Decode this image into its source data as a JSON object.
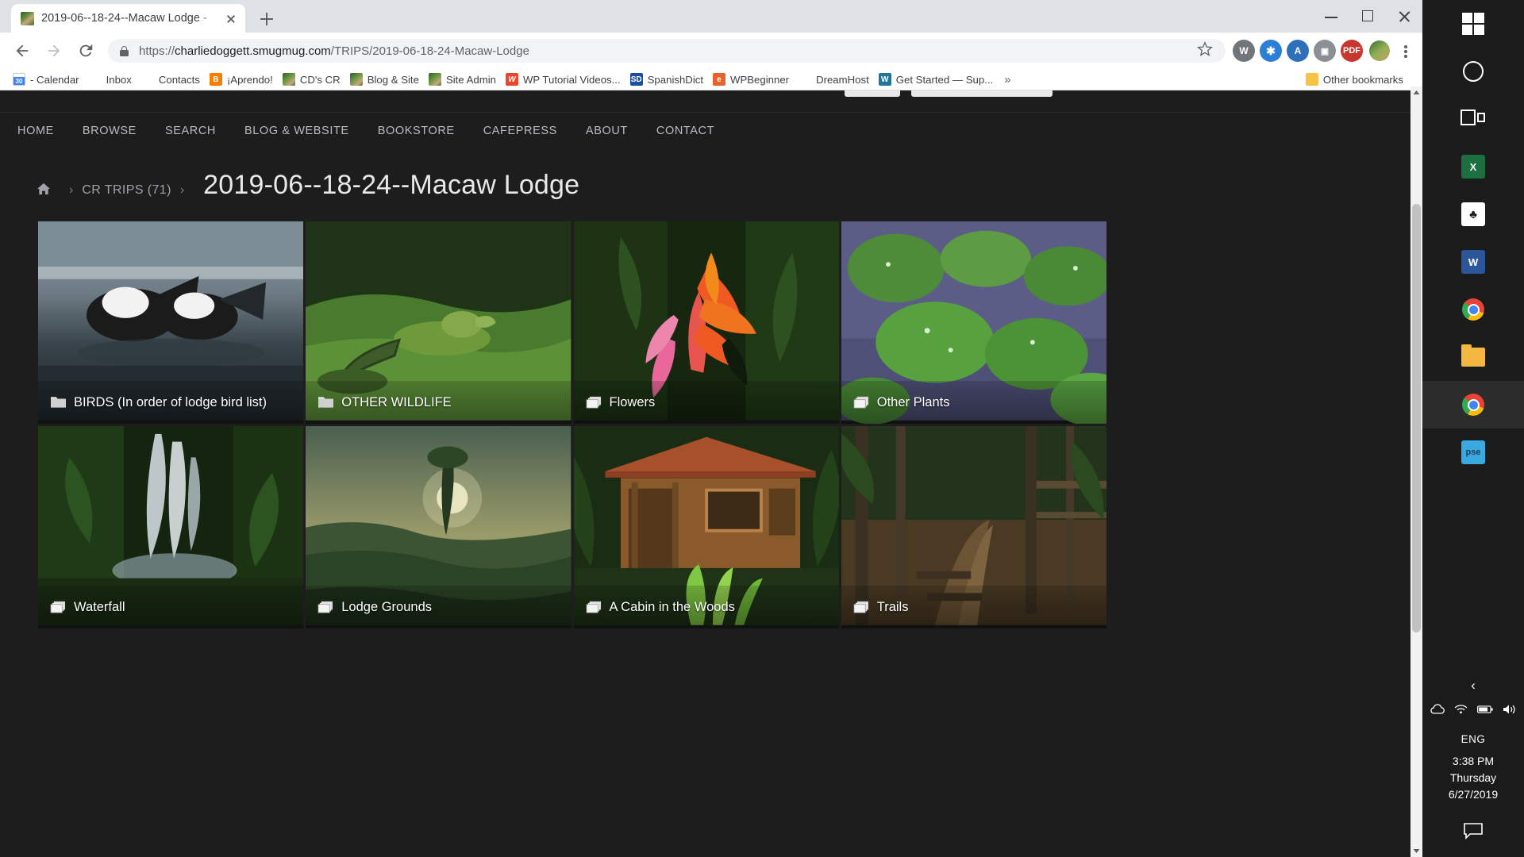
{
  "browser": {
    "tab": {
      "title": "2019-06--18-24--Macaw Lodge -",
      "favicon": "photo-favicon"
    },
    "newtab_label": "+",
    "window_controls": {
      "minimize": "minimize",
      "maximize": "maximize",
      "close": "close"
    },
    "nav": {
      "back": "back-arrow",
      "forward": "forward-arrow",
      "reload": "reload-icon"
    },
    "omnibox": {
      "lock": "secure-lock-icon",
      "url_scheme": "https://",
      "url_main": "charliedoggett.smugmug.com",
      "url_path": "/TRIPS/2019-06-18-24-Macaw-Lodge",
      "url_full": "https://charliedoggett.smugmug.com/TRIPS/2019-06-18-24-Macaw-Lodge",
      "bookmark_star": "star-icon"
    },
    "extensions": [
      {
        "name": "wordpress-extension",
        "label": "W",
        "color": "#5a5a5a"
      },
      {
        "name": "grammar-extension",
        "label": "✻",
        "color": "#2b7fd4"
      },
      {
        "name": "acrobat-extension-a",
        "label": "A",
        "color": "#2d6fb8"
      },
      {
        "name": "screen-extension",
        "label": "▣",
        "color": "#7a7a7a"
      },
      {
        "name": "pdf-extension",
        "label": "⌂",
        "color": "#c8372d"
      }
    ],
    "profile_avatar": "user-avatar",
    "menu": "chrome-menu-icon",
    "bookmarks": [
      {
        "label": "- Calendar",
        "icon": "calendar-icon"
      },
      {
        "label": "Inbox",
        "icon": "gmail-icon"
      },
      {
        "label": "Contacts",
        "icon": "gmail-icon"
      },
      {
        "label": "¡Aprendo!",
        "icon": "blogger-icon"
      },
      {
        "label": "CD's CR",
        "icon": "photo-icon"
      },
      {
        "label": "Blog & Site",
        "icon": "photo-icon"
      },
      {
        "label": "Site Admin",
        "icon": "photo-icon"
      },
      {
        "label": "WP Tutorial Videos...",
        "icon": "wordpress-icon"
      },
      {
        "label": "SpanishDict",
        "icon": "spanishdict-icon"
      },
      {
        "label": "WPBeginner",
        "icon": "wpbeginner-icon"
      },
      {
        "label": "DreamHost",
        "icon": "dreamhost-icon"
      },
      {
        "label": "Get Started — Sup...",
        "icon": "wordpress-circle-icon"
      }
    ],
    "bookmarks_overflow": "»",
    "other_bookmarks": {
      "label": "Other bookmarks",
      "icon": "folder-icon"
    }
  },
  "site": {
    "nav_items": [
      {
        "label": "HOME"
      },
      {
        "label": "BROWSE"
      },
      {
        "label": "SEARCH"
      },
      {
        "label": "BLOG & WEBSITE"
      },
      {
        "label": "BOOKSTORE"
      },
      {
        "label": "CAFEPRESS"
      },
      {
        "label": "ABOUT"
      },
      {
        "label": "CONTACT"
      }
    ],
    "breadcrumb": {
      "home_icon": "home-icon",
      "separator": "›",
      "parent": "CR TRIPS (71)",
      "title": "2019-06--18-24--Macaw Lodge"
    },
    "gallery": [
      {
        "caption": "BIRDS (In order of lodge bird list)",
        "icon": "folder-icon",
        "alt": "two black-and-white ducks splashing in water"
      },
      {
        "caption": "OTHER WILDLIFE",
        "icon": "folder-icon",
        "alt": "green iguana on grass"
      },
      {
        "caption": "Flowers",
        "icon": "photo-stack-icon",
        "alt": "red and orange heliconia flower"
      },
      {
        "caption": "Other Plants",
        "icon": "photo-stack-icon",
        "alt": "lily pads on water"
      },
      {
        "caption": "Waterfall",
        "icon": "photo-stack-icon",
        "alt": "jungle waterfall"
      },
      {
        "caption": "Lodge Grounds",
        "icon": "photo-stack-icon",
        "alt": "sunset over rainforest canopy"
      },
      {
        "caption": "A Cabin in the Woods",
        "icon": "photo-stack-icon",
        "alt": "wooden cabin with tile roof"
      },
      {
        "caption": "Trails",
        "icon": "photo-stack-icon",
        "alt": "forest trail with steps"
      }
    ]
  },
  "taskbar": {
    "items": [
      {
        "name": "start-button",
        "icon": "windows-logo-icon",
        "active": false
      },
      {
        "name": "cortana-search",
        "icon": "cortana-circle-icon",
        "active": false
      },
      {
        "name": "task-view",
        "icon": "task-view-icon",
        "active": false
      },
      {
        "name": "excel",
        "icon": "excel-icon",
        "label": "X",
        "active": false
      },
      {
        "name": "solitaire",
        "icon": "solitaire-icon",
        "label": "♣",
        "active": false
      },
      {
        "name": "word",
        "icon": "word-icon",
        "label": "W",
        "active": false
      },
      {
        "name": "chrome-pinned",
        "icon": "chrome-icon",
        "active": false
      },
      {
        "name": "file-explorer",
        "icon": "file-explorer-icon",
        "active": false
      },
      {
        "name": "chrome-window",
        "icon": "chrome-icon",
        "active": true
      },
      {
        "name": "photoshop-elements",
        "icon": "pse-icon",
        "label": "pse",
        "active": false
      }
    ],
    "tray": {
      "chevron": "‹",
      "icons": [
        "cloud-icon",
        "wifi-icon",
        "battery-icon",
        "volume-icon"
      ],
      "language": "ENG",
      "time": "3:38 PM",
      "day": "Thursday",
      "date": "6/27/2019",
      "action_center": "action-center-icon"
    }
  }
}
